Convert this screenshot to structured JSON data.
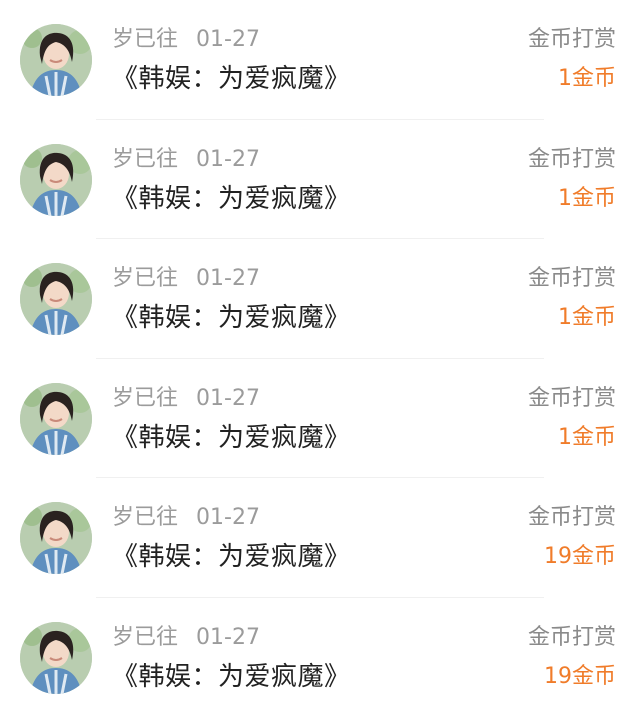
{
  "colors": {
    "accent": "#f07c2a",
    "meta": "#9b9b9b",
    "title": "#222222",
    "type": "#8a8a8a"
  },
  "items": [
    {
      "username": "岁已往",
      "date": "01-27",
      "title": "《韩娱：为爱疯魔》",
      "type": "金币打赏",
      "amount": "1金币",
      "avatar_icon": "user-avatar-icon"
    },
    {
      "username": "岁已往",
      "date": "01-27",
      "title": "《韩娱：为爱疯魔》",
      "type": "金币打赏",
      "amount": "1金币",
      "avatar_icon": "user-avatar-icon"
    },
    {
      "username": "岁已往",
      "date": "01-27",
      "title": "《韩娱：为爱疯魔》",
      "type": "金币打赏",
      "amount": "1金币",
      "avatar_icon": "user-avatar-icon"
    },
    {
      "username": "岁已往",
      "date": "01-27",
      "title": "《韩娱：为爱疯魔》",
      "type": "金币打赏",
      "amount": "1金币",
      "avatar_icon": "user-avatar-icon"
    },
    {
      "username": "岁已往",
      "date": "01-27",
      "title": "《韩娱：为爱疯魔》",
      "type": "金币打赏",
      "amount": "19金币",
      "avatar_icon": "user-avatar-icon"
    },
    {
      "username": "岁已往",
      "date": "01-27",
      "title": "《韩娱：为爱疯魔》",
      "type": "金币打赏",
      "amount": "19金币",
      "avatar_icon": "user-avatar-icon"
    }
  ]
}
